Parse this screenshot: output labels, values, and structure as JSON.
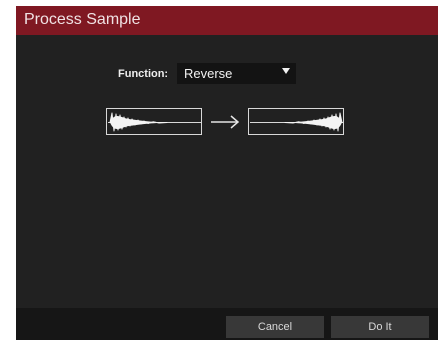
{
  "dialog": {
    "title": "Process Sample"
  },
  "function_field": {
    "label": "Function:",
    "value": "Reverse"
  },
  "preview": {
    "before_icon": "waveform-decay-icon",
    "arrow_icon": "right-arrow-icon",
    "after_icon": "waveform-reversed-icon"
  },
  "footer": {
    "cancel_label": "Cancel",
    "doit_label": "Do It"
  },
  "colors": {
    "title_bar": "#7f1822",
    "dialog_bg": "#212121",
    "footer_bg": "#161616",
    "button_bg": "#383838",
    "select_bg": "#131313"
  }
}
